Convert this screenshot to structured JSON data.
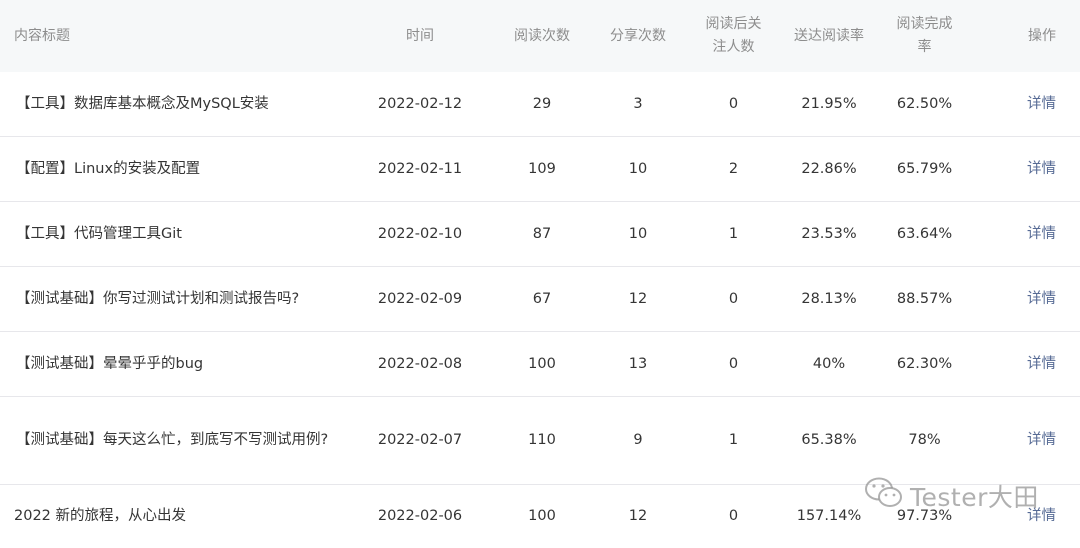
{
  "columns": {
    "title": "内容标题",
    "time": "时间",
    "reads": "阅读次数",
    "shares": "分享次数",
    "follows": "阅读后关注人数",
    "reach_rate": "送达阅读率",
    "completion_rate": "阅读完成率",
    "action": "操作"
  },
  "rows": [
    {
      "title": "【工具】数据库基本概念及MySQL安装",
      "time": "2022-02-12",
      "reads": "29",
      "shares": "3",
      "follows": "0",
      "reach_rate": "21.95%",
      "completion_rate": "62.50%",
      "action": "详情"
    },
    {
      "title": "【配置】Linux的安装及配置",
      "time": "2022-02-11",
      "reads": "109",
      "shares": "10",
      "follows": "2",
      "reach_rate": "22.86%",
      "completion_rate": "65.79%",
      "action": "详情"
    },
    {
      "title": "【工具】代码管理工具Git",
      "time": "2022-02-10",
      "reads": "87",
      "shares": "10",
      "follows": "1",
      "reach_rate": "23.53%",
      "completion_rate": "63.64%",
      "action": "详情"
    },
    {
      "title": "【测试基础】你写过测试计划和测试报告吗?",
      "time": "2022-02-09",
      "reads": "67",
      "shares": "12",
      "follows": "0",
      "reach_rate": "28.13%",
      "completion_rate": "88.57%",
      "action": "详情"
    },
    {
      "title": "【测试基础】晕晕乎乎的bug",
      "time": "2022-02-08",
      "reads": "100",
      "shares": "13",
      "follows": "0",
      "reach_rate": "40%",
      "completion_rate": "62.30%",
      "action": "详情"
    },
    {
      "title": "【测试基础】每天这么忙，到底写不写测试用例?",
      "time": "2022-02-07",
      "reads": "110",
      "shares": "9",
      "follows": "1",
      "reach_rate": "65.38%",
      "completion_rate": "78%",
      "action": "详情"
    },
    {
      "title": "2022 新的旅程，从心出发",
      "time": "2022-02-06",
      "reads": "100",
      "shares": "12",
      "follows": "0",
      "reach_rate": "157.14%",
      "completion_rate": "97.73%",
      "action": "详情"
    }
  ],
  "watermark": {
    "text": "Tester大田",
    "icon": "wechat-icon"
  }
}
